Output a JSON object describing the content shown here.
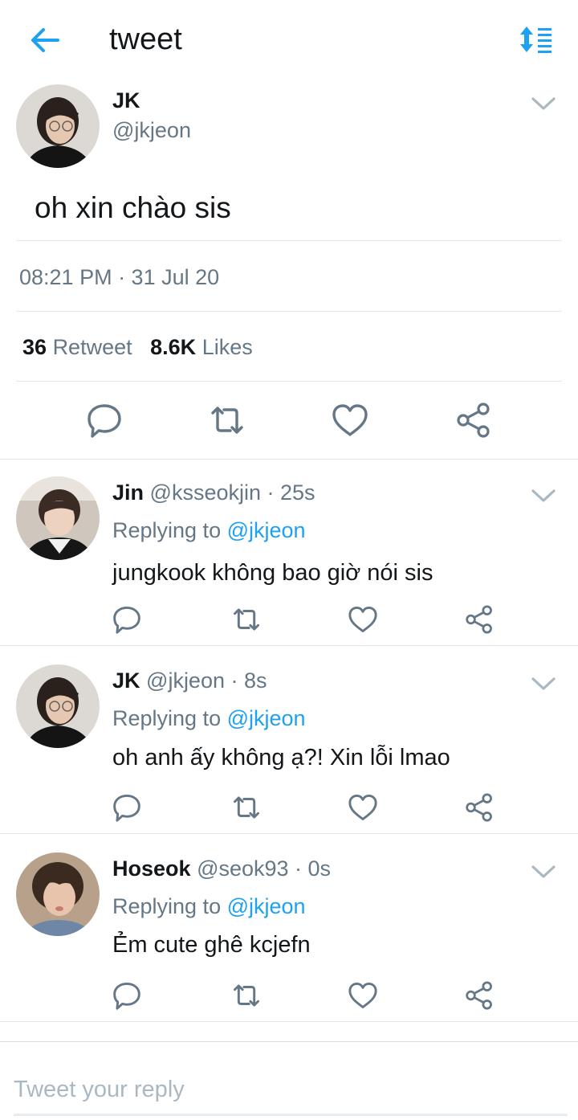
{
  "header": {
    "title": "tweet",
    "back_icon": "arrow-left-icon",
    "sort_icon": "sort-icon",
    "accent": "#1da1f2"
  },
  "main_tweet": {
    "name": "JK",
    "handle": "@jkjeon",
    "text": "oh xin chào sis",
    "timestamp": "08:21 PM · 31 Jul 20",
    "retweet_count": "36",
    "retweet_label": "Retweet",
    "like_count": "8.6K",
    "like_label": "Likes"
  },
  "replies": [
    {
      "name": "Jin",
      "meta": "@ksseokjin · 25s",
      "replying_label": "Replying to",
      "mention": "@jkjeon",
      "text": "jungkook không bao giờ nói sis"
    },
    {
      "name": "JK",
      "meta": "@jkjeon · 8s",
      "replying_label": "Replying to",
      "mention": "@jkjeon",
      "text": "oh anh ấy không ạ?! Xin lỗi lmao"
    },
    {
      "name": "Hoseok",
      "meta": "@seok93 · 0s",
      "replying_label": "Replying to",
      "mention": "@jkjeon",
      "text": "Ẻm cute ghê kcjefn"
    }
  ],
  "compose": {
    "placeholder": "Tweet your reply"
  },
  "colors": {
    "text": "#14171a",
    "muted": "#657786",
    "link": "#1da1f2",
    "divider": "#e1e8ed"
  }
}
